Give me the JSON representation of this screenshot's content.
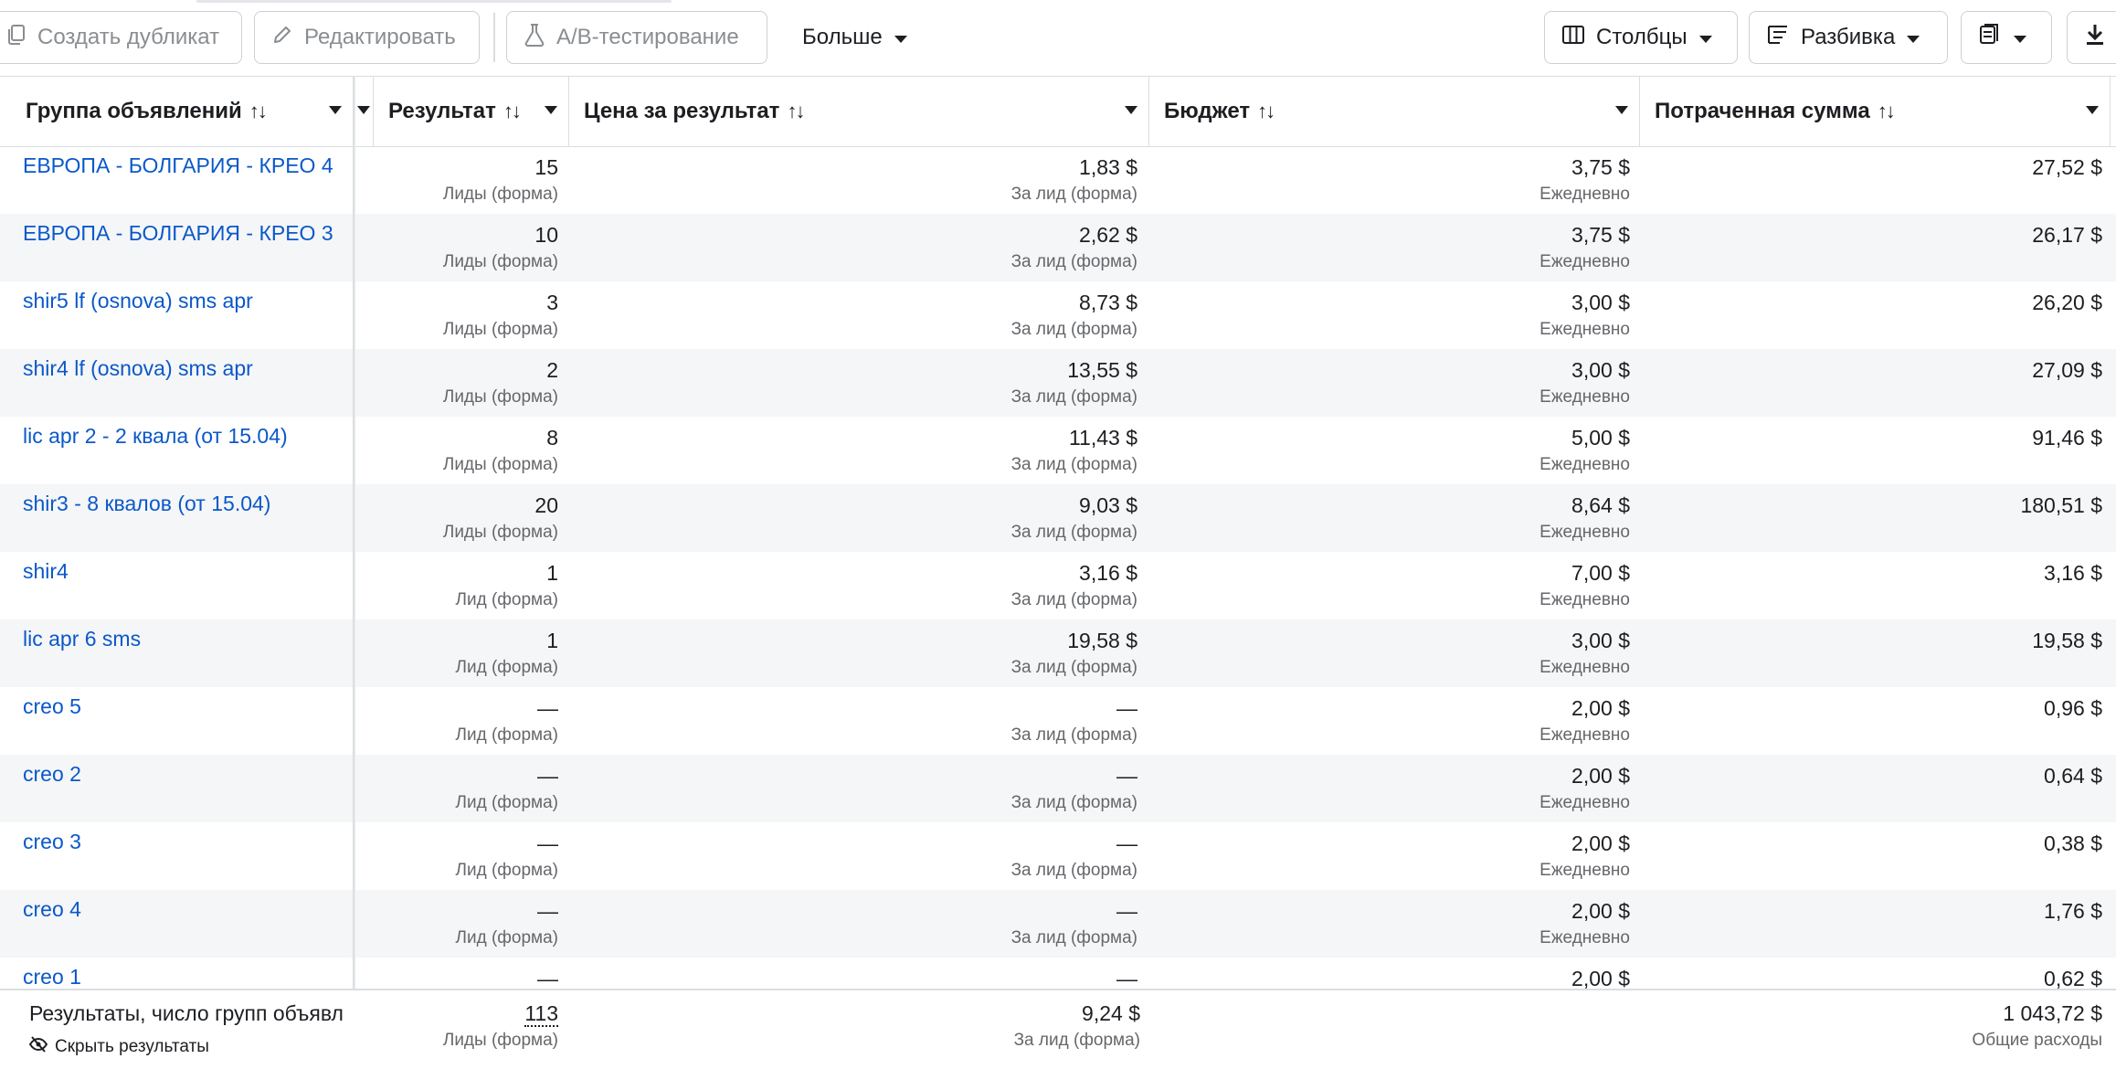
{
  "toolbar": {
    "duplicate": "Создать дубликат",
    "edit": "Редактировать",
    "ab_test": "A/B-тестирование",
    "more": "Больше",
    "columns": "Столбцы",
    "breakdown": "Разбивка"
  },
  "headers": {
    "adset": "Группа объявлений",
    "result": "Результат",
    "cost": "Цена за результат",
    "budget": "Бюджет",
    "spent": "Потраченная сумма",
    "sort_glyph": "↑↓"
  },
  "rows": [
    {
      "name": "ЕВРОПА - БОЛГАРИЯ - КРЕО 4",
      "result": "15",
      "result_sub": "Лиды (форма)",
      "cost": "1,83 $",
      "cost_sub": "За лид (форма)",
      "budget": "3,75 $",
      "budget_sub": "Ежедневно",
      "spent": "27,52 $"
    },
    {
      "name": "ЕВРОПА - БОЛГАРИЯ - КРЕО 3",
      "result": "10",
      "result_sub": "Лиды (форма)",
      "cost": "2,62 $",
      "cost_sub": "За лид (форма)",
      "budget": "3,75 $",
      "budget_sub": "Ежедневно",
      "spent": "26,17 $"
    },
    {
      "name": "shir5 lf (osnova) sms apr",
      "result": "3",
      "result_sub": "Лиды (форма)",
      "cost": "8,73 $",
      "cost_sub": "За лид (форма)",
      "budget": "3,00 $",
      "budget_sub": "Ежедневно",
      "spent": "26,20 $"
    },
    {
      "name": "shir4 lf (osnova) sms apr",
      "result": "2",
      "result_sub": "Лиды (форма)",
      "cost": "13,55 $",
      "cost_sub": "За лид (форма)",
      "budget": "3,00 $",
      "budget_sub": "Ежедневно",
      "spent": "27,09 $"
    },
    {
      "name": "lic apr 2 - 2 квала (от 15.04)",
      "result": "8",
      "result_sub": "Лиды (форма)",
      "cost": "11,43 $",
      "cost_sub": "За лид (форма)",
      "budget": "5,00 $",
      "budget_sub": "Ежедневно",
      "spent": "91,46 $"
    },
    {
      "name": "shir3 - 8 квалов (от 15.04)",
      "result": "20",
      "result_sub": "Лиды (форма)",
      "cost": "9,03 $",
      "cost_sub": "За лид (форма)",
      "budget": "8,64 $",
      "budget_sub": "Ежедневно",
      "spent": "180,51 $"
    },
    {
      "name": "shir4",
      "result": "1",
      "result_sub": "Лид (форма)",
      "cost": "3,16 $",
      "cost_sub": "За лид (форма)",
      "budget": "7,00 $",
      "budget_sub": "Ежедневно",
      "spent": "3,16 $"
    },
    {
      "name": "lic apr 6 sms",
      "result": "1",
      "result_sub": "Лид (форма)",
      "cost": "19,58 $",
      "cost_sub": "За лид (форма)",
      "budget": "3,00 $",
      "budget_sub": "Ежедневно",
      "spent": "19,58 $"
    },
    {
      "name": "creo 5",
      "result": "—",
      "result_sub": "Лид (форма)",
      "cost": "—",
      "cost_sub": "За лид (форма)",
      "budget": "2,00 $",
      "budget_sub": "Ежедневно",
      "spent": "0,96 $"
    },
    {
      "name": "creo 2",
      "result": "—",
      "result_sub": "Лид (форма)",
      "cost": "—",
      "cost_sub": "За лид (форма)",
      "budget": "2,00 $",
      "budget_sub": "Ежедневно",
      "spent": "0,64 $"
    },
    {
      "name": "creo 3",
      "result": "—",
      "result_sub": "Лид (форма)",
      "cost": "—",
      "cost_sub": "За лид (форма)",
      "budget": "2,00 $",
      "budget_sub": "Ежедневно",
      "spent": "0,38 $"
    },
    {
      "name": "creo 4",
      "result": "—",
      "result_sub": "Лид (форма)",
      "cost": "—",
      "cost_sub": "За лид (форма)",
      "budget": "2,00 $",
      "budget_sub": "Ежедневно",
      "spent": "1,76 $"
    },
    {
      "name": "creo 1",
      "result": "—",
      "result_sub": "",
      "cost": "—",
      "cost_sub": "",
      "budget": "2,00 $",
      "budget_sub": "",
      "spent": "0,62 $"
    }
  ],
  "footer": {
    "label": "Результаты, число групп объявл",
    "hide": "Скрыть результаты",
    "result": "113",
    "result_sub": "Лиды (форма)",
    "cost": "9,24 $",
    "cost_sub": "За лид (форма)",
    "spent": "1 043,72 $",
    "spent_sub": "Общие расходы"
  }
}
